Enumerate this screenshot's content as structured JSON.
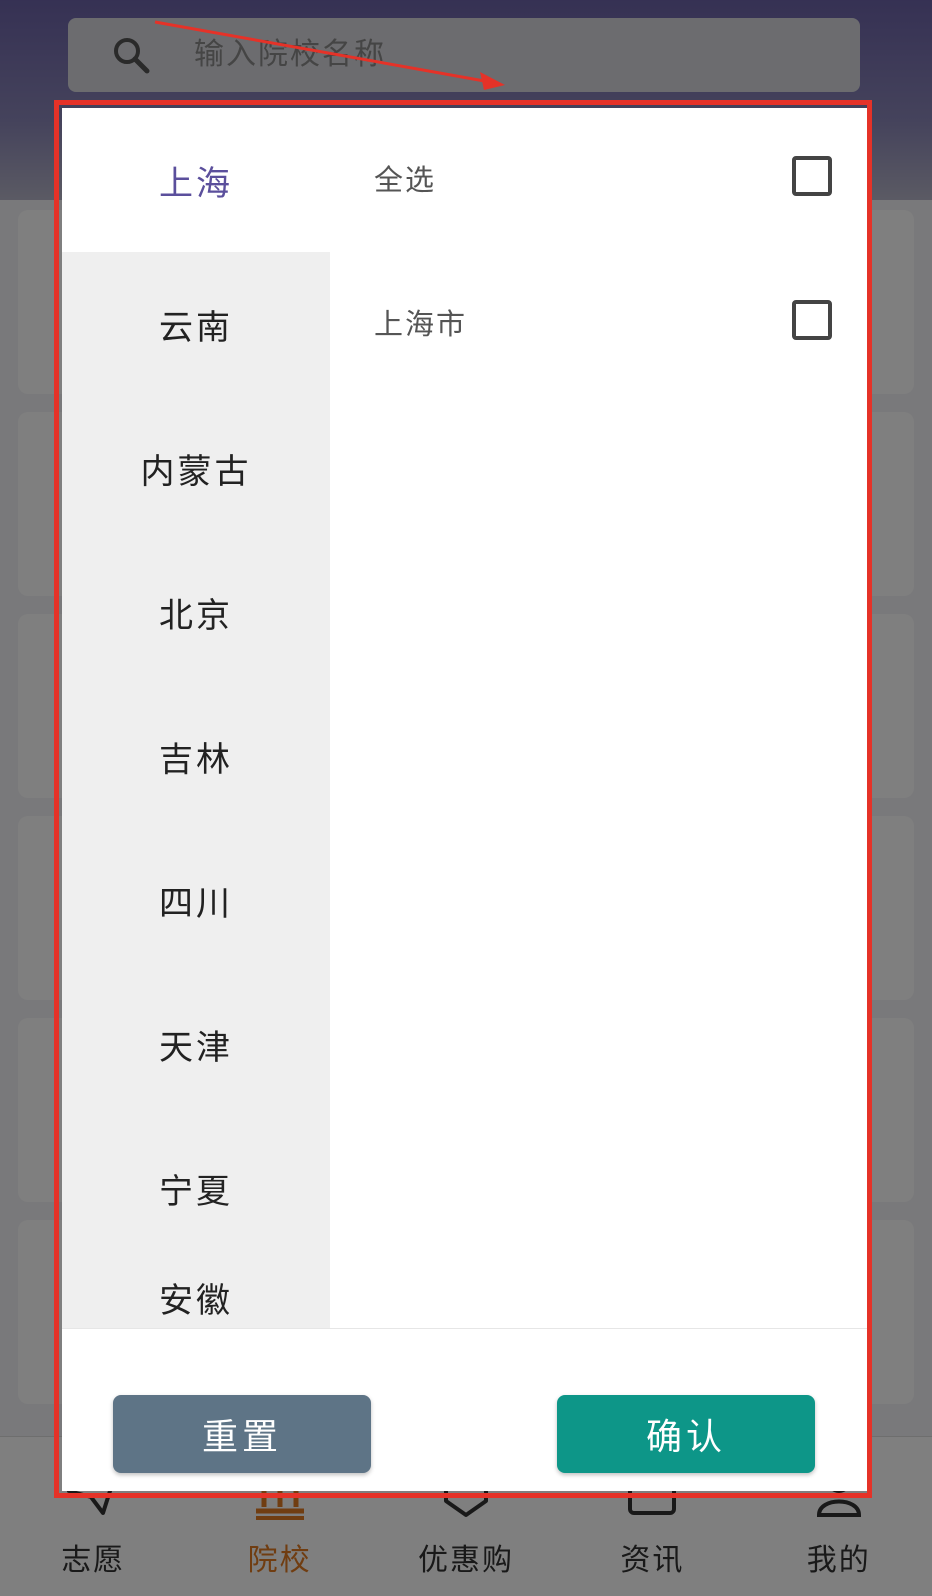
{
  "search": {
    "placeholder": "输入院校名称"
  },
  "bottom_nav": {
    "items": [
      {
        "label": "志愿",
        "icon": "paper-plane-icon",
        "active": false
      },
      {
        "label": "院校",
        "icon": "building-icon",
        "active": true
      },
      {
        "label": "优惠购",
        "icon": "shop-bag-icon",
        "active": false
      },
      {
        "label": "资讯",
        "icon": "news-icon",
        "active": false
      },
      {
        "label": "我的",
        "icon": "user-icon",
        "active": false
      }
    ]
  },
  "filter_dialog": {
    "provinces": [
      "上海",
      "云南",
      "内蒙古",
      "北京",
      "吉林",
      "四川",
      "天津",
      "宁夏",
      "安徽"
    ],
    "selected_province": "上海",
    "cities": [
      {
        "label": "全选",
        "checked": false
      },
      {
        "label": "上海市",
        "checked": false
      }
    ],
    "reset_label": "重置",
    "confirm_label": "确认"
  },
  "colors": {
    "accent_purple": "#5b4f9c",
    "confirm_teal": "#0d9688",
    "reset_slate": "#5e7486",
    "annotation_red": "#e53228",
    "active_nav_orange": "#e07b22"
  }
}
